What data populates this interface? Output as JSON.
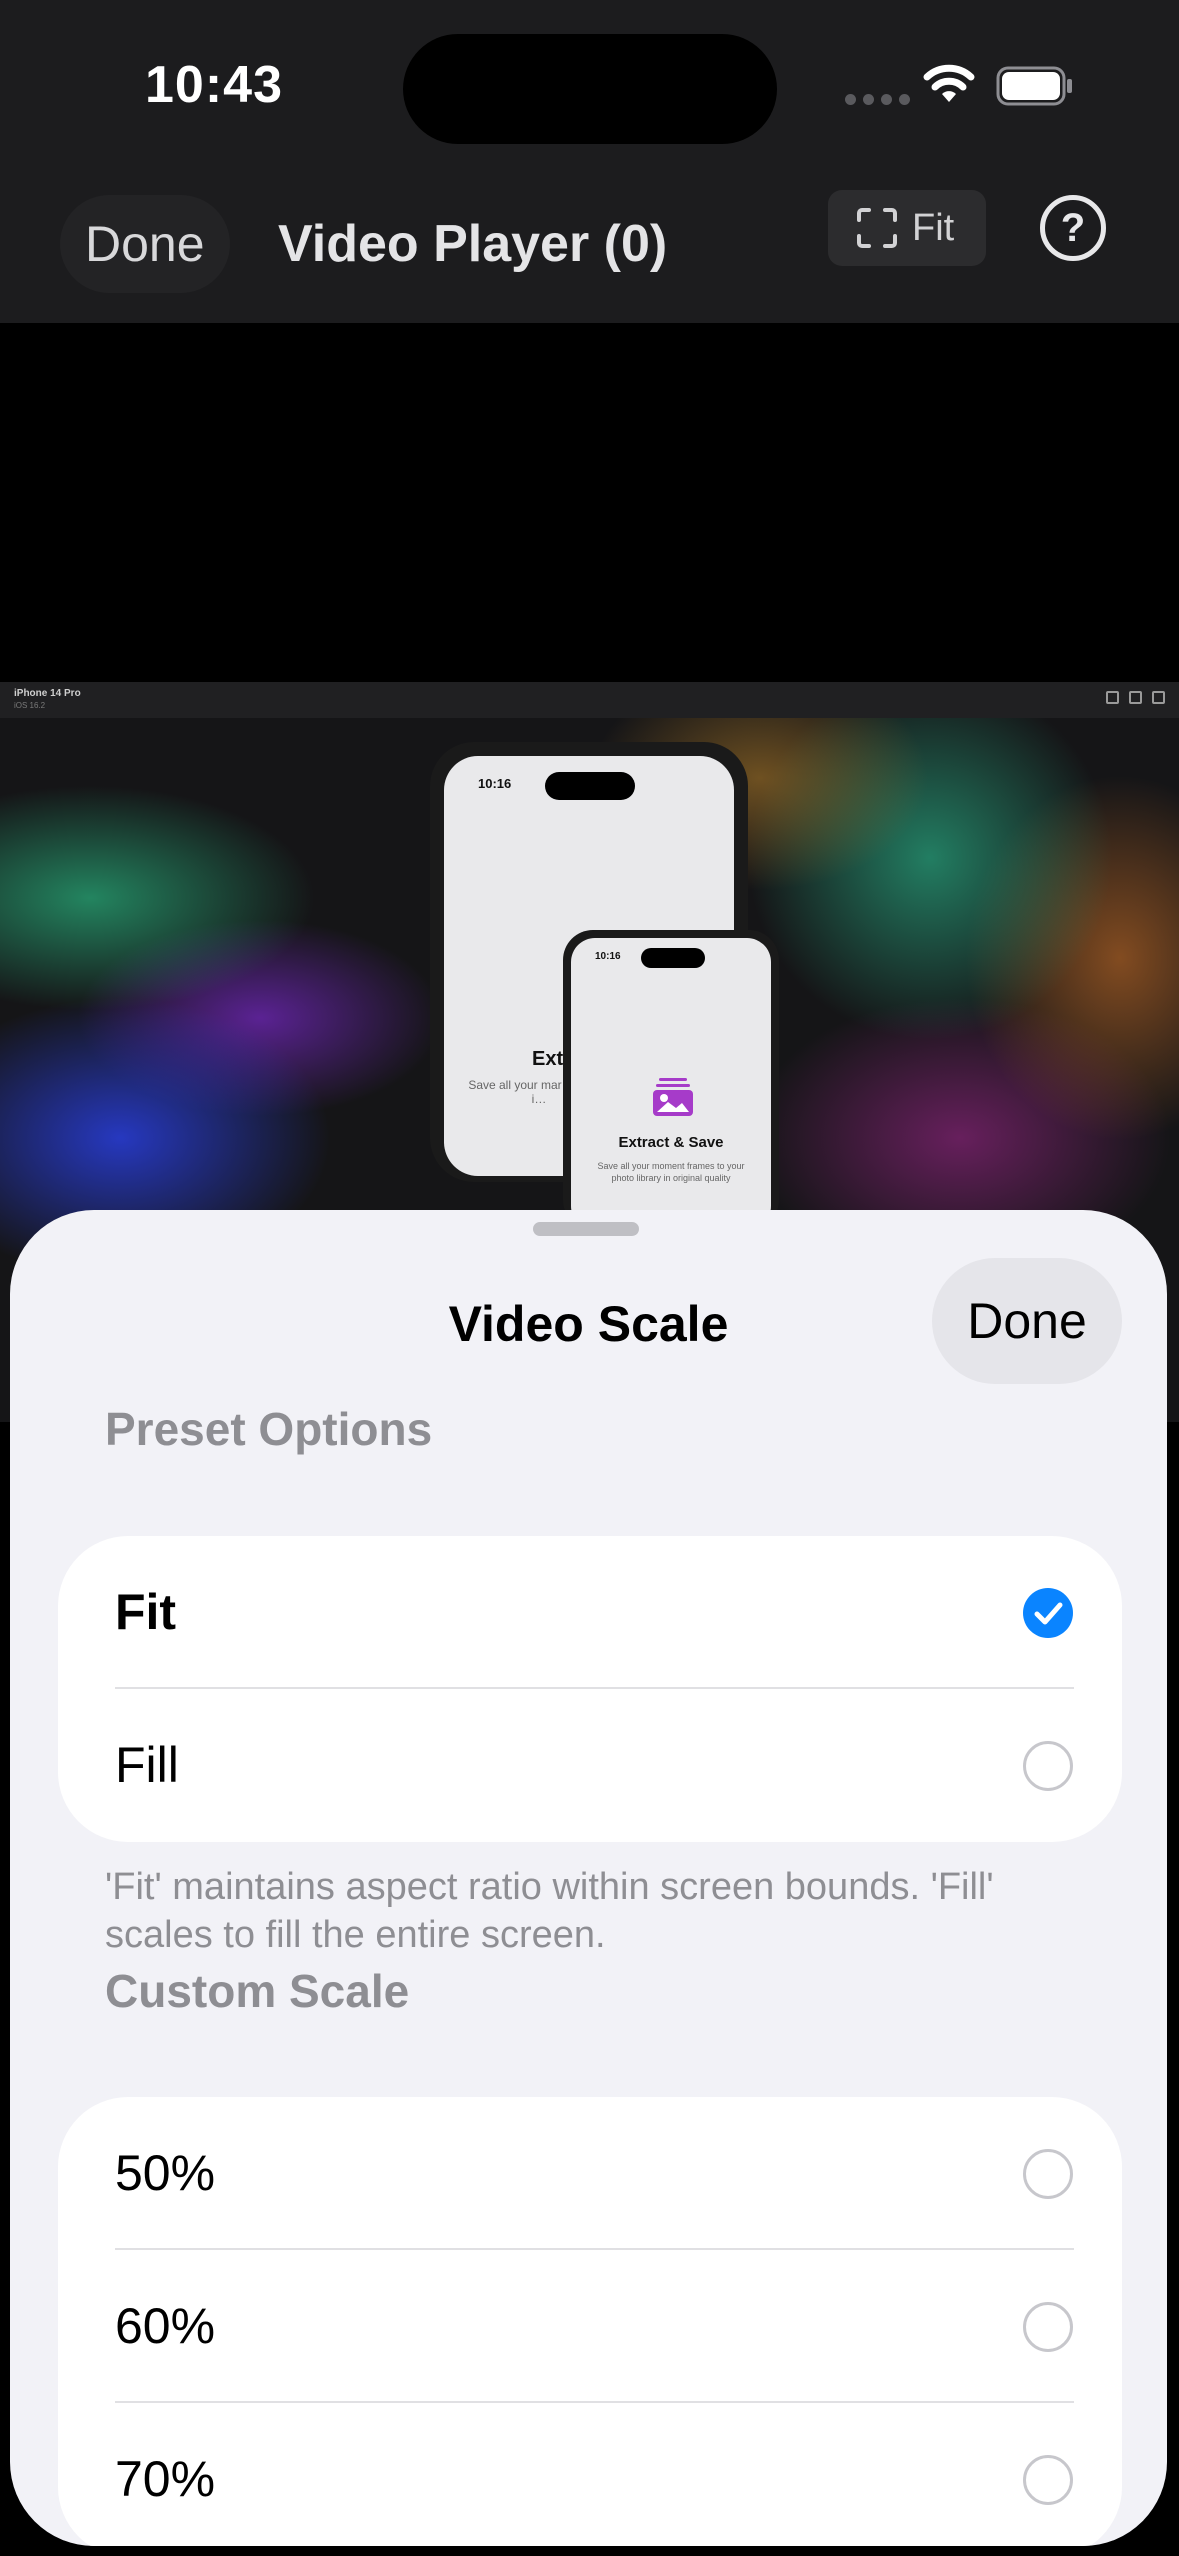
{
  "status_bar": {
    "time": "10:43"
  },
  "nav": {
    "done_label": "Done",
    "title": "Video Player (0)",
    "scale_label": "Fit"
  },
  "simulator": {
    "device_name": "iPhone 14 Pro",
    "os_version": "iOS 16.2",
    "phone_large": {
      "time": "10:16",
      "title": "Extra",
      "subtitle": "Save all your mar… library i…"
    },
    "phone_small": {
      "time": "10:16",
      "title": "Extract & Save",
      "subtitle": "Save all your moment frames to your photo library in original quality"
    }
  },
  "sheet": {
    "title": "Video Scale",
    "done_label": "Done",
    "preset_header": "Preset Options",
    "preset_options": [
      {
        "label": "Fit",
        "selected": true
      },
      {
        "label": "Fill",
        "selected": false
      }
    ],
    "preset_footer": "'Fit' maintains aspect ratio within screen bounds. 'Fill' scales to fill the entire screen.",
    "custom_header": "Custom Scale",
    "custom_options": [
      {
        "label": "50%",
        "selected": false
      },
      {
        "label": "60%",
        "selected": false
      },
      {
        "label": "70%",
        "selected": false
      }
    ]
  },
  "colors": {
    "accent": "#0a84ff",
    "sheet_bg": "#f2f2f7",
    "nav_bg": "#1c1c1e",
    "extract_icon": "#a63bc9"
  }
}
